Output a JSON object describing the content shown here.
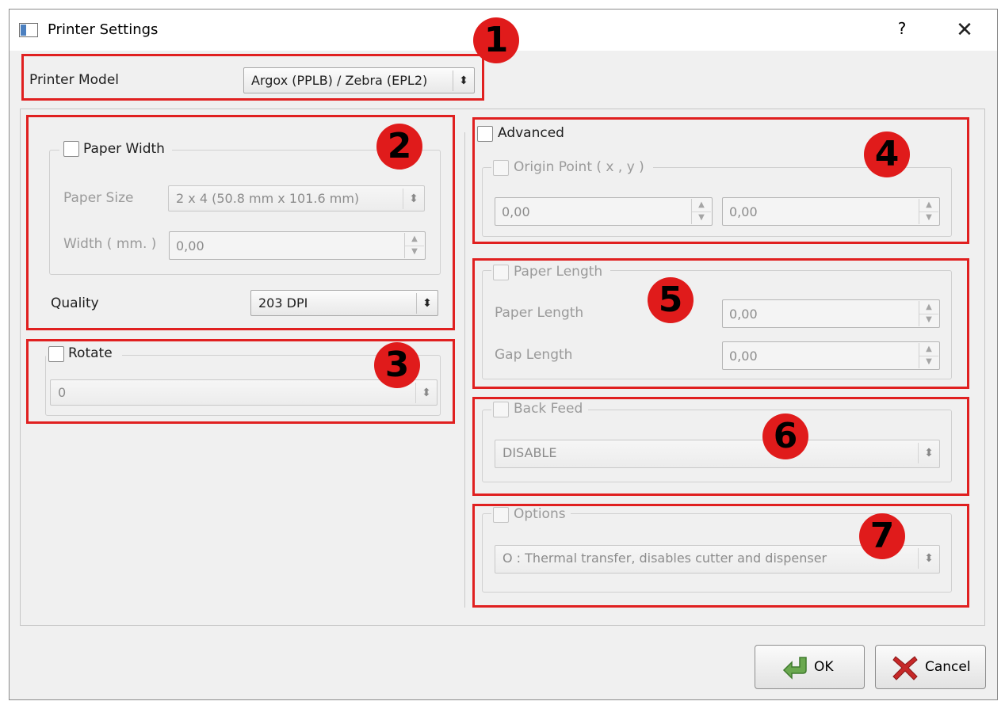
{
  "window": {
    "title": "Printer Settings",
    "help": "?",
    "close": "✕"
  },
  "printer_model": {
    "label": "Printer Model",
    "value": "Argox (PPLB) / Zebra (EPL2)"
  },
  "paper_width": {
    "checkbox_label": "Paper Width",
    "paper_size_label": "Paper Size",
    "paper_size_value": "2 x 4 (50.8 mm x 101.6 mm)",
    "width_label": "Width ( mm. )",
    "width_value": "0,00"
  },
  "quality": {
    "label": "Quality",
    "value": "203 DPI"
  },
  "rotate": {
    "checkbox_label": "Rotate",
    "value": "0"
  },
  "advanced": {
    "checkbox_label": "Advanced",
    "origin_label": "Origin Point ( x , y )",
    "origin_x": "0,00",
    "origin_y": "0,00"
  },
  "paper_length": {
    "checkbox_label": "Paper Length",
    "length_label": "Paper Length",
    "length_value": "0,00",
    "gap_label": "Gap Length",
    "gap_value": "0,00"
  },
  "back_feed": {
    "checkbox_label": "Back Feed",
    "value": "DISABLE"
  },
  "options": {
    "checkbox_label": "Options",
    "value": "O : Thermal transfer, disables cutter and dispenser"
  },
  "annotations": [
    "1",
    "2",
    "3",
    "4",
    "5",
    "6",
    "7"
  ],
  "buttons": {
    "ok": "OK",
    "cancel": "Cancel"
  },
  "colors": {
    "annotation_red": "#e02020",
    "dialog_bg": "#f0f0f0",
    "title_bg": "#ffffff"
  }
}
